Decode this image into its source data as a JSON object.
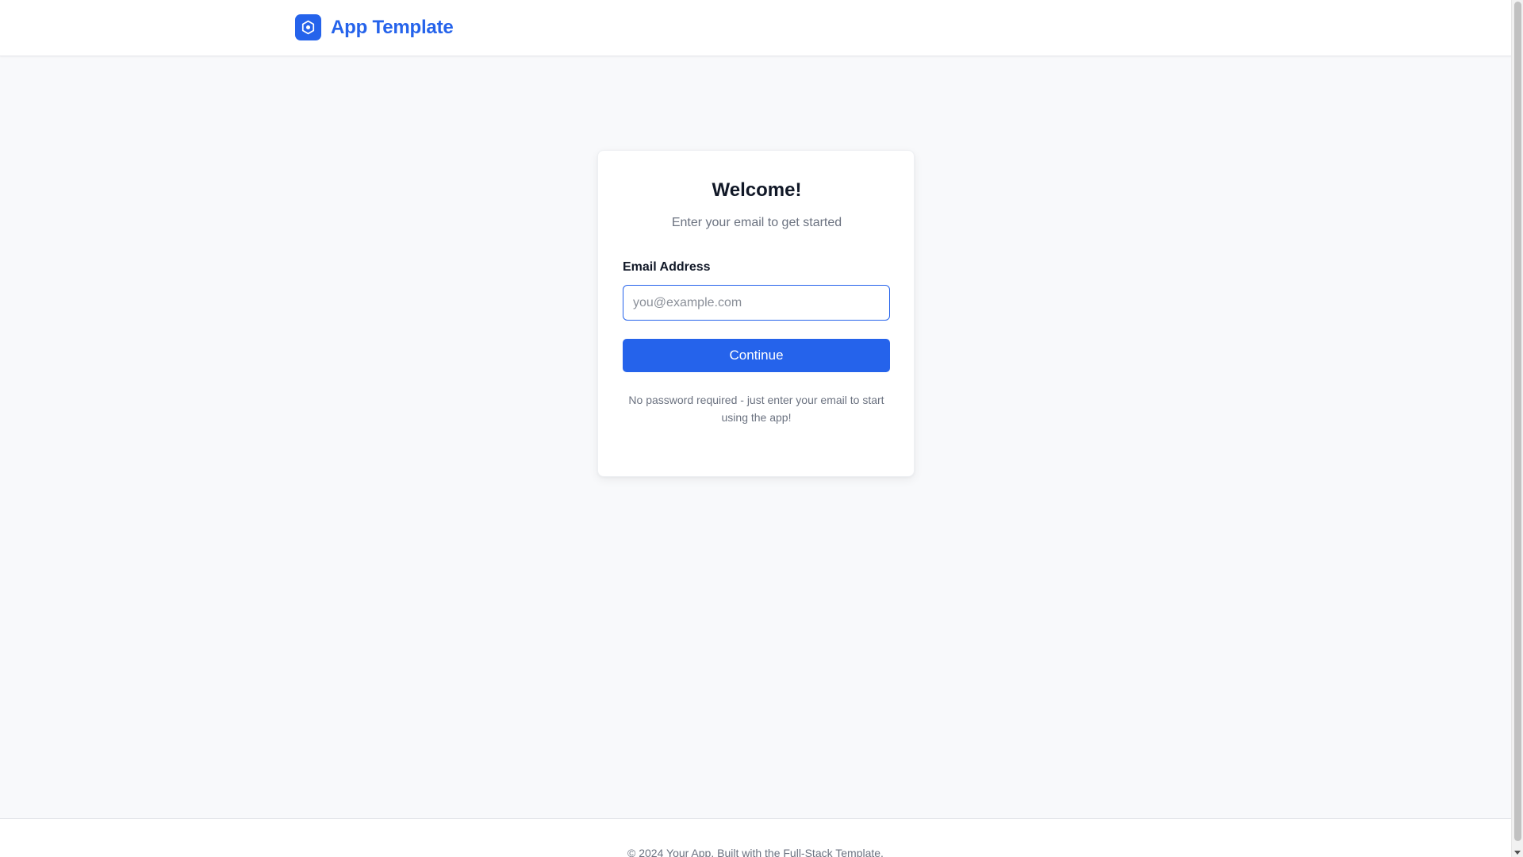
{
  "header": {
    "brand_name": "App Template",
    "logo_icon": "hexagon-shield-icon",
    "accent_color": "#2563eb"
  },
  "login_card": {
    "title": "Welcome!",
    "subtitle": "Enter your email to get started",
    "email_label": "Email Address",
    "email_value": "",
    "email_placeholder": "you@example.com",
    "continue_label": "Continue",
    "helper_text": "No password required - just enter your email to start using the app!"
  },
  "footer": {
    "text": "© 2024 Your App. Built with the Full-Stack Template."
  }
}
